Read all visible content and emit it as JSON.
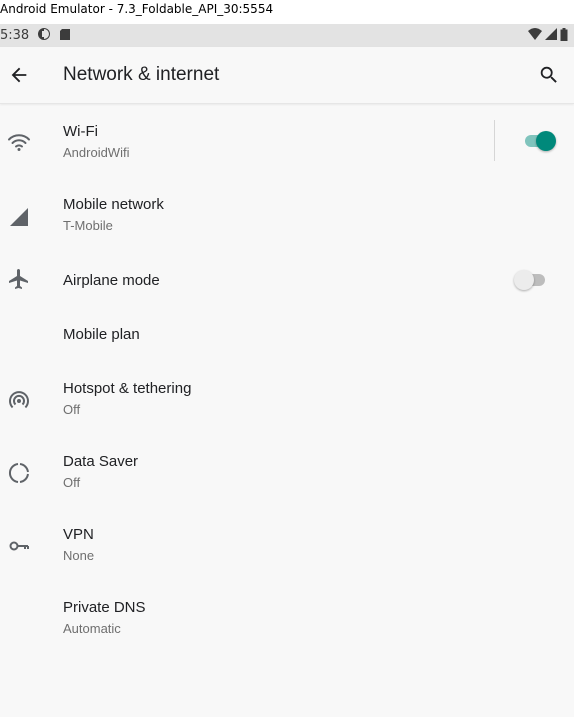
{
  "window_title": "Android Emulator - 7.3_Foldable_API_30:5554",
  "status_bar": {
    "time": "5:38"
  },
  "toolbar": {
    "title": "Network & internet"
  },
  "colors": {
    "accent": "#00897b",
    "accent_track": "#80c4bd"
  },
  "items": [
    {
      "title": "Wi-Fi",
      "summary": "AndroidWifi",
      "icon": "wifi-icon",
      "toggle_on": true
    },
    {
      "title": "Mobile network",
      "summary": "T-Mobile",
      "icon": "cell-signal-icon"
    },
    {
      "title": "Airplane mode",
      "summary": "",
      "icon": "airplane-icon",
      "toggle_on": false
    },
    {
      "title": "Mobile plan",
      "summary": ""
    },
    {
      "title": "Hotspot & tethering",
      "summary": "Off",
      "icon": "hotspot-icon"
    },
    {
      "title": "Data Saver",
      "summary": "Off",
      "icon": "data-saver-icon"
    },
    {
      "title": "VPN",
      "summary": "None",
      "icon": "vpn-key-icon"
    },
    {
      "title": "Private DNS",
      "summary": "Automatic"
    }
  ]
}
